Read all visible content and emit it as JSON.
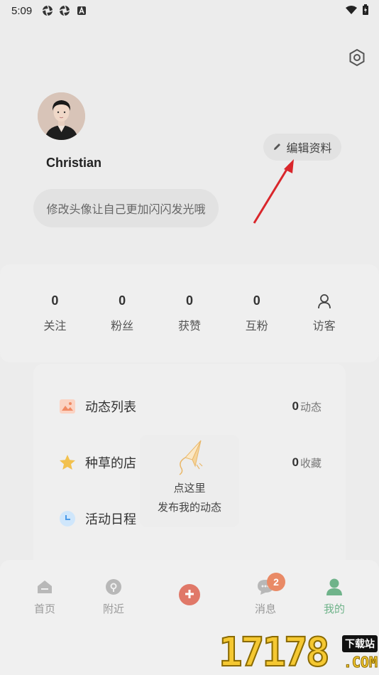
{
  "status_bar": {
    "time": "5:09",
    "left_icons": [
      "aperture-icon",
      "aperture-icon",
      "a-box-icon"
    ],
    "right_icons": [
      "wifi-icon",
      "battery-icon"
    ]
  },
  "profile": {
    "username": "Christian",
    "edit_label": "编辑资料",
    "bio_prompt": "修改头像让自己更加闪闪发光哦"
  },
  "stats": [
    {
      "value": "0",
      "label": "关注"
    },
    {
      "value": "0",
      "label": "粉丝"
    },
    {
      "value": "0",
      "label": "获赞"
    },
    {
      "value": "0",
      "label": "互粉"
    },
    {
      "value": "",
      "label": "访客",
      "icon": "person-icon"
    }
  ],
  "list": [
    {
      "label": "动态列表",
      "count": "0",
      "unit": "动态",
      "icon": "image-icon",
      "color": "#f4a58a"
    },
    {
      "label": "种草的店",
      "count": "0",
      "unit": "收藏",
      "icon": "star-icon",
      "color": "#f2c14e"
    },
    {
      "label": "活动日程",
      "count": "",
      "unit": "",
      "icon": "clock-icon",
      "color": "#7ab8f0"
    }
  ],
  "publish_prompt": {
    "line1": "点这里",
    "line2": "发布我的动态"
  },
  "tabbar": {
    "tabs": [
      {
        "label": "首页",
        "icon": "home-icon"
      },
      {
        "label": "附近",
        "icon": "location-icon"
      },
      {
        "label": "",
        "icon": "plus-icon"
      },
      {
        "label": "消息",
        "icon": "chat-icon",
        "badge": "2"
      },
      {
        "label": "我的",
        "icon": "user-icon",
        "active": true
      }
    ]
  },
  "watermark": {
    "digits": "17178",
    "tag": "下载站",
    "domain": ".COM"
  },
  "colors": {
    "accent_green": "#6fb38a",
    "badge": "#e98a66",
    "publish_red": "#e07868",
    "arrow_red": "#d9262b"
  }
}
